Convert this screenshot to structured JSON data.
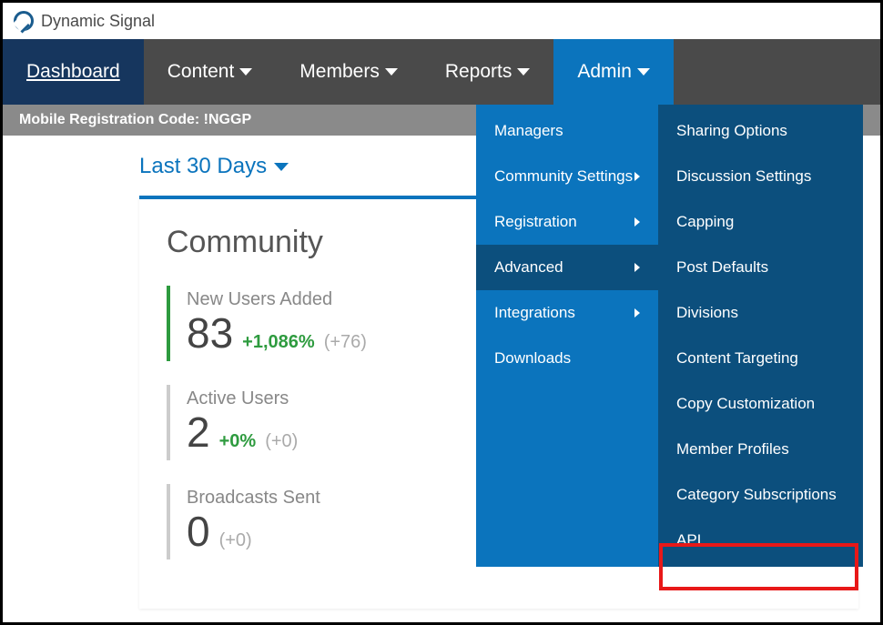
{
  "brand": {
    "name": "Dynamic Signal"
  },
  "nav": {
    "dashboard": "Dashboard",
    "content": "Content",
    "members": "Members",
    "reports": "Reports",
    "admin": "Admin"
  },
  "regbar": {
    "label": "Mobile Registration Code: ",
    "code": "!NGGP"
  },
  "period": {
    "label": "Last 30 Days"
  },
  "community": {
    "title": "Community",
    "metrics": [
      {
        "label": "New Users Added",
        "value": "83",
        "pct": "+1,086%",
        "delta": "(+76)"
      },
      {
        "label": "Active Users",
        "value": "2",
        "pct": "+0%",
        "delta": "(+0)"
      },
      {
        "label": "Broadcasts Sent",
        "value": "0",
        "pct": "",
        "delta": "(+0)"
      }
    ]
  },
  "adminMenu": {
    "col1": [
      {
        "label": "Managers",
        "arrow": false,
        "selected": false
      },
      {
        "label": "Community Settings",
        "arrow": true,
        "selected": false
      },
      {
        "label": "Registration",
        "arrow": true,
        "selected": false
      },
      {
        "label": "Advanced",
        "arrow": true,
        "selected": true
      },
      {
        "label": "Integrations",
        "arrow": true,
        "selected": false
      },
      {
        "label": "Downloads",
        "arrow": false,
        "selected": false
      }
    ],
    "col2": [
      {
        "label": "Sharing Options"
      },
      {
        "label": "Discussion Settings"
      },
      {
        "label": "Capping"
      },
      {
        "label": "Post Defaults"
      },
      {
        "label": "Divisions"
      },
      {
        "label": "Content Targeting"
      },
      {
        "label": "Copy Customization"
      },
      {
        "label": "Member Profiles"
      },
      {
        "label": "Category Subscriptions"
      },
      {
        "label": "API"
      }
    ]
  }
}
